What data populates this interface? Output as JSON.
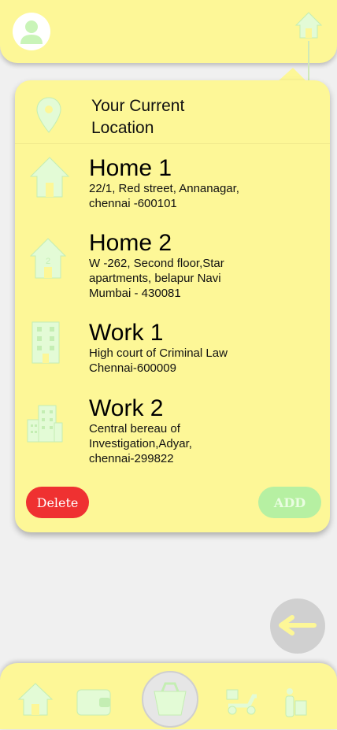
{
  "header": {
    "avatar_icon": "user-avatar-icon",
    "home_icon": "home-icon"
  },
  "locations_card": {
    "current_location_label": "Your Current Location",
    "current_location_icon": "map-pin-icon",
    "items": [
      {
        "title": "Home 1",
        "address": "22/1, Red street, Annanagar,\nchennai -600101",
        "icon": "home-icon"
      },
      {
        "title": "Home 2",
        "address": "W -262, Second floor,Star\napartments, belapur Navi\nMumbai - 430081",
        "icon": "home-2-icon"
      },
      {
        "title": "Work 1",
        "address": "High court of Criminal Law\nChennai-600009",
        "icon": "office-building-icon"
      },
      {
        "title": "Work 2",
        "address": "Central bereau of\nInvestigation,Adyar,\nchennai-299822",
        "icon": "city-buildings-icon"
      }
    ],
    "delete_label": "Delete",
    "add_label": "ADD"
  },
  "back_button": {
    "icon": "arrow-left-icon"
  },
  "bottom_nav": {
    "items": [
      "home-icon",
      "wallet-icon",
      "basket-icon",
      "delivery-scooter-icon",
      "delivery-person-icon"
    ]
  },
  "colors": {
    "card_bg": "#fdf797",
    "icon_green": "#e3fbd6",
    "delete": "#ef3131",
    "add": "#b6f0a2"
  }
}
